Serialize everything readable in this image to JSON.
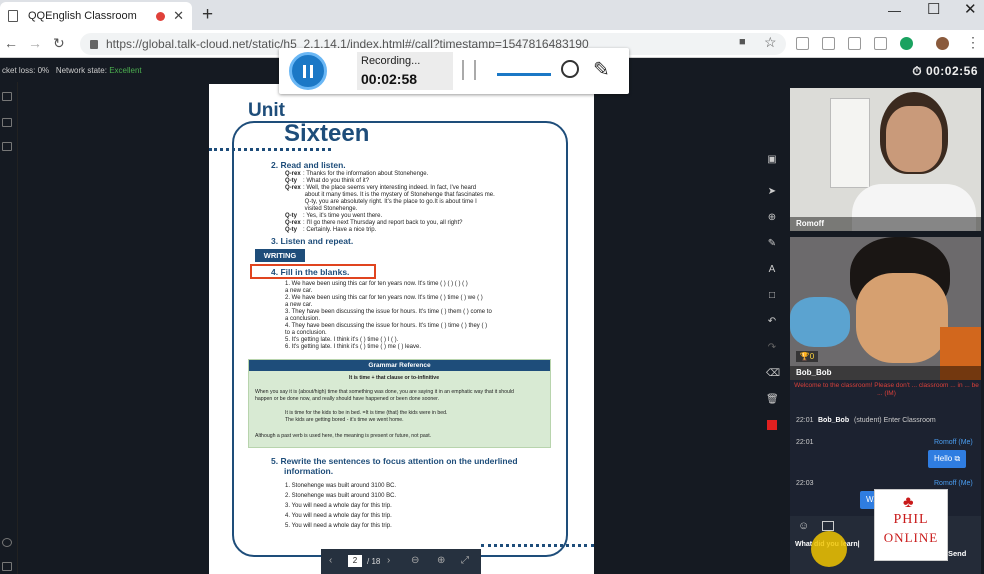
{
  "browser": {
    "tab_title": "QQEnglish Classroom",
    "url": "https://global.talk-cloud.net/static/h5_2.1.14.1/index.html#/call?timestamp=1547816483190"
  },
  "status": {
    "loss": "cket loss: 0%",
    "net_label": "Network state:",
    "net_value": "Excellent",
    "clock": "00:02:56"
  },
  "recorder": {
    "label": "Recording...",
    "time": "00:02:58"
  },
  "doc": {
    "unit": "Unit",
    "sixteen": "Sixteen",
    "s2": "2.   Read and listen.",
    "dialog": [
      {
        "s": "Q-rex",
        "t": ": Thanks for the information about Stonehenge."
      },
      {
        "s": "Q-ty",
        "t": ": What do you think of it?"
      },
      {
        "s": "Q-rex",
        "t": ": Well, the place seems very interesting indeed. In fact, I've heard"
      },
      {
        "s": "",
        "t": "   about it many times. It is the mystery of Stonehenge that fascinates me."
      },
      {
        "s": "",
        "t": "   Q-ty, you are absolutely right. It's the place to go.It is about time I"
      },
      {
        "s": "",
        "t": "   visited Stonehenge."
      },
      {
        "s": "Q-ty",
        "t": ": Yes, it's time you went there."
      },
      {
        "s": "Q-rex",
        "t": ": I'll go there next Thursday and report back to you, all right?"
      },
      {
        "s": "Q-ty",
        "t": ": Certainly. Have a nice trip."
      }
    ],
    "s3": "3.   Listen and repeat.",
    "writing": "WRITING",
    "s4": "4.   Fill in the blanks.",
    "blanks": [
      "1.   We have been using this car for ten years now. It's time (     ) (     ) (     ) (     )",
      "          a new car.",
      "2.   We have been using this car for ten years now. It's time (     ) time (     ) we (     )",
      "          a new car.",
      "3.   They have been discussing the issue for hours. It's time (     ) them (     ) come to",
      "          a conclusion.",
      "4.   They have been discussing the issue for hours. It's time (     ) time (     ) they (     )",
      "          to a conclusion.",
      "5.   It's getting late. I think it's (     ) time (     ) I (     ).",
      "6.   It's getting late. I think it's (     ) time (     ) me (     ) leave."
    ],
    "grammar": {
      "title": "Grammar Reference",
      "formula": "It is time + that clause or to-infinitive",
      "p1": "When you say it is (about/high) time that something was done, you are saying it in an emphatic way that it should",
      "p2": "happen or be done now, and really should have happened or been done sooner.",
      "e1": "It is time for the kids to be in bed. =It is time (that) the kids were in bed.",
      "e2": "The kids are getting bored - it's time we went home.",
      "p3": "Although a past verb is used here, the meaning is present or future, not past."
    },
    "s5a": "5.   Rewrite the sentences to focus attention on the underlined",
    "s5b": "information.",
    "rewrite": [
      "1.     Stonehenge was built around 3100 BC.",
      "2.     Stonehenge was built around 3100 BC.",
      "3.     You will need a whole day for this trip.",
      "4.     You will need a whole day for this trip.",
      "5.     You will need a whole day for this trip."
    ]
  },
  "pager": {
    "page": "2",
    "total": "/ 18"
  },
  "video": {
    "teacher": "Romoff",
    "student": "Bob_Bob",
    "badge": "0",
    "tag": "Listen"
  },
  "chat": {
    "system": "Welcome to the classroom! Please don't ... classroom ... in ... be ... (IM)",
    "m1_time": "22:01",
    "m1_name": "Bob_Bob",
    "m1_text": "(student)   Enter Classroom",
    "m2_time": "22:01",
    "m2_name": "Romoff (Me)",
    "m2_text": "Hello",
    "m3_time": "22:03",
    "m3_name": "Romoff (Me)",
    "m3_text": "W...y?",
    "input": "What did you learn|",
    "send": "Send"
  },
  "logo": {
    "line1": "PHIL",
    "line2": "ONLINE"
  }
}
